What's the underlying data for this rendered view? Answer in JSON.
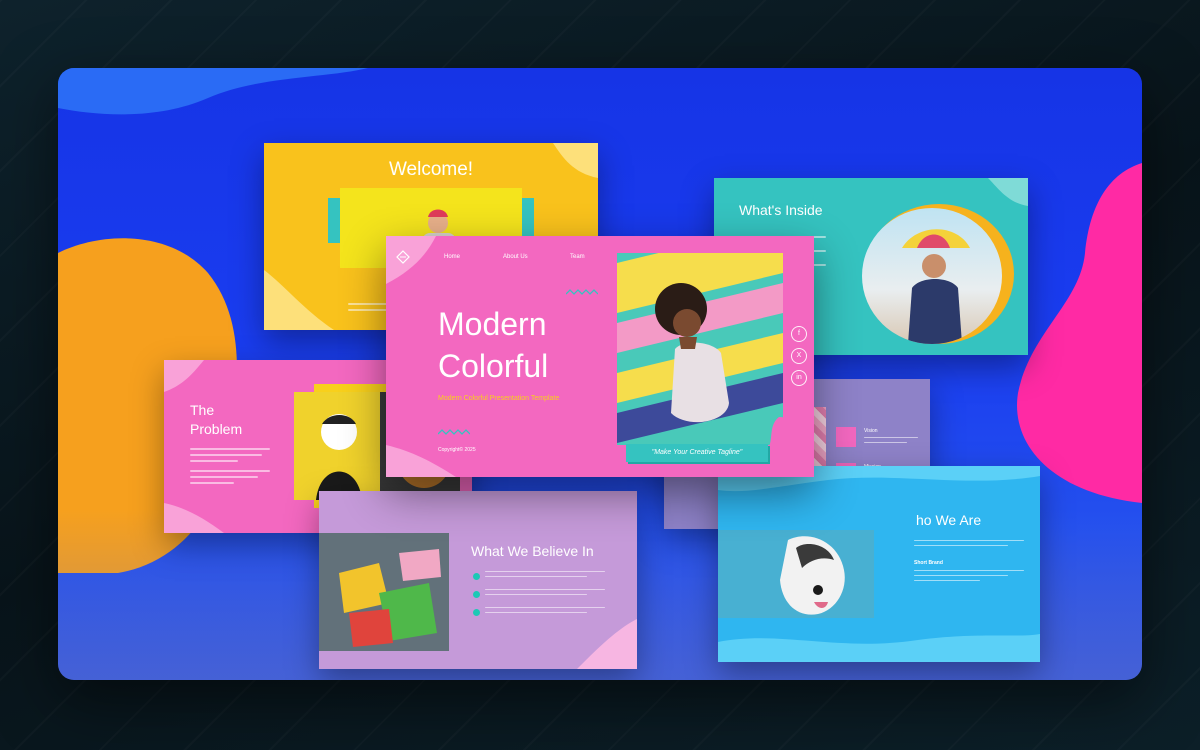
{
  "slides": {
    "welcome": {
      "title": "Welcome!"
    },
    "whats_inside": {
      "title": "What's Inside"
    },
    "main": {
      "nav": [
        "Home",
        "About Us",
        "Team"
      ],
      "title_line1": "Modern",
      "title_line2": "Colorful",
      "subtitle": "Modern Colorful Presentation Template",
      "copyright": "Copyright© 2025",
      "tagline": "\"Make Your Creative Tagline\"",
      "social": [
        "f",
        "X",
        "in"
      ]
    },
    "problem": {
      "title_line1": "The",
      "title_line2": "Problem"
    },
    "vision": {
      "items": [
        "Vision",
        "Mission"
      ]
    },
    "believe": {
      "title": "What We Believe In"
    },
    "who": {
      "title": "ho We Are",
      "sub_label": "Short Brand"
    }
  },
  "colors": {
    "board": "#1a3df0",
    "welcome_bg": "#f9c21c",
    "main_bg": "#f368c0",
    "teal": "#35c3c0",
    "purple": "#8e82c8",
    "lilac": "#c59ad9",
    "sky": "#2fb6f0",
    "accent_yellow": "#f8d01c"
  }
}
